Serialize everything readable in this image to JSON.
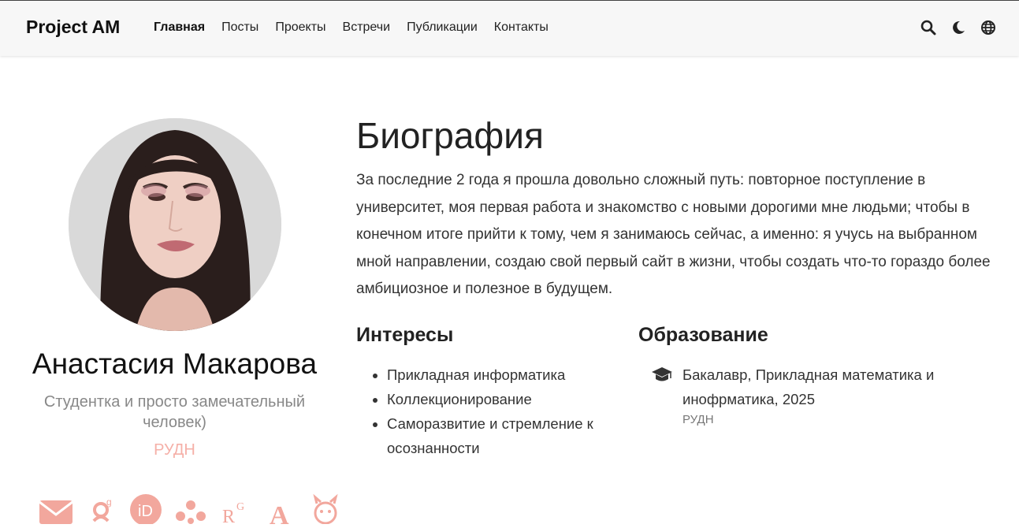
{
  "navbar": {
    "brand": "Project AM",
    "links": [
      "Главная",
      "Посты",
      "Проекты",
      "Встречи",
      "Публикации",
      "Контакты"
    ],
    "active_index": 0,
    "icons": [
      "search-icon",
      "moon-icon",
      "globe-icon"
    ]
  },
  "profile": {
    "name": "Анастасия Макарова",
    "role": "Студентка и просто замечательный человек)",
    "organization": "РУДН",
    "social_icons": [
      "envelope-icon",
      "google-scholar-icon",
      "orcid-icon",
      "network-icon",
      "researchgate-icon",
      "academia-icon",
      "cat-icon"
    ]
  },
  "biography": {
    "title": "Биография",
    "text": "За последние 2 года я прошла довольно сложный путь: повторное поступление в университет, моя первая работа и знакомство с новыми дорогими мне людьми; чтобы в конечном итоге прийти к тому, чем я занимаюсь сейчас, а именно: я учусь на выбранном мной направлении, создаю свой первый сайт в жизни, чтобы создать что-то гораздо более амбициозное и полезное в будущем."
  },
  "interests": {
    "title": "Интересы",
    "items": [
      "Прикладная информатика",
      "Коллекционирование",
      "Саморазвитие и стремление к осознанности"
    ]
  },
  "education": {
    "title": "Образование",
    "items": [
      {
        "degree": "Бакалавр, Прикладная математика и инофрматика, 2025",
        "institution": "РУДН"
      }
    ]
  },
  "colors": {
    "accent": "#f2a79d",
    "navbar_bg": "#f7f7f7"
  }
}
